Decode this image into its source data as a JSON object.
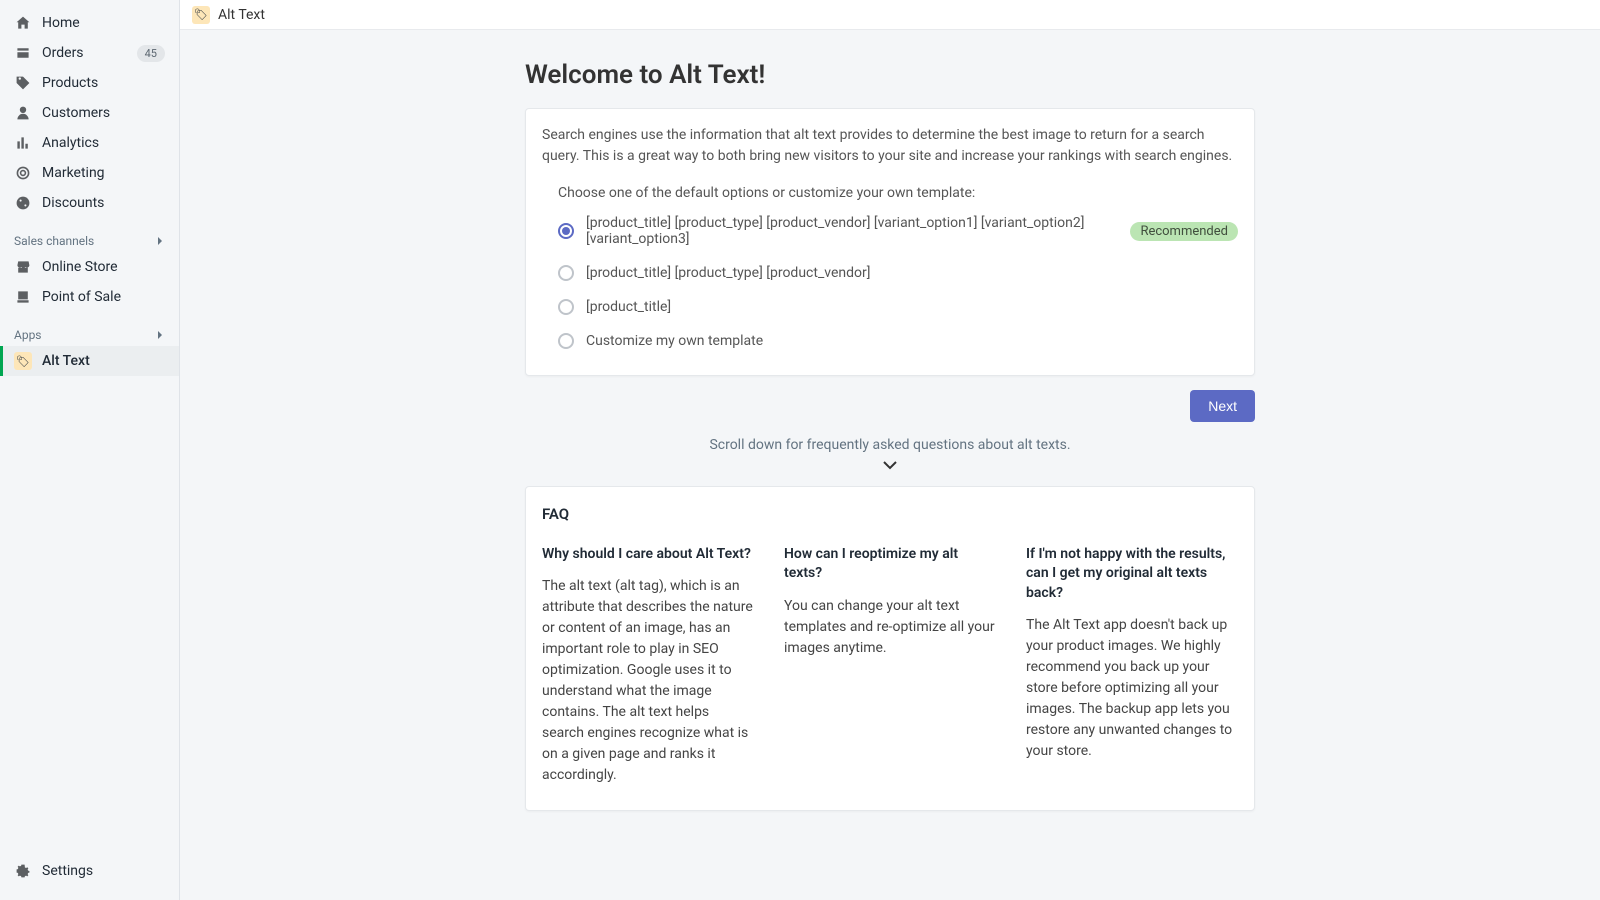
{
  "sidebar": {
    "items": [
      {
        "label": "Home"
      },
      {
        "label": "Orders",
        "badge": "45"
      },
      {
        "label": "Products"
      },
      {
        "label": "Customers"
      },
      {
        "label": "Analytics"
      },
      {
        "label": "Marketing"
      },
      {
        "label": "Discounts"
      }
    ],
    "sales_channels_header": "Sales channels",
    "channels": [
      {
        "label": "Online Store"
      },
      {
        "label": "Point of Sale"
      }
    ],
    "apps_header": "Apps",
    "apps": [
      {
        "label": "Alt Text"
      }
    ],
    "settings_label": "Settings"
  },
  "topbar": {
    "title": "Alt Text"
  },
  "page": {
    "title": "Welcome to Alt Text!",
    "intro": "Search engines use the information that alt text provides to determine the best image to return for a search query. This is a great way to both bring new visitors to your site and increase your rankings with search engines.",
    "choose_label": "Choose one of the default options or customize your own template:",
    "options": [
      {
        "label": "[product_title] [product_type] [product_vendor] [variant_option1] [variant_option2] [variant_option3]",
        "recommended": true,
        "selected": true
      },
      {
        "label": "[product_title] [product_type] [product_vendor]"
      },
      {
        "label": "[product_title]"
      },
      {
        "label": "Customize my own template"
      }
    ],
    "recommended_label": "Recommended",
    "next_label": "Next",
    "scroll_hint": "Scroll down for frequently asked questions about alt texts."
  },
  "faq": {
    "title": "FAQ",
    "items": [
      {
        "q": "Why should I care about Alt Text?",
        "a": "The alt text (alt tag), which is an attribute that describes the nature or content of an image, has an important role to play in SEO optimization. Google uses it to understand what the image contains. The alt text helps search engines recognize what is on a given page and ranks it accordingly."
      },
      {
        "q": "How can I reoptimize my alt texts?",
        "a": "You can change your alt text templates and re-optimize all your images anytime."
      },
      {
        "q": "If I'm not happy with the results, can I get my original alt texts back?",
        "a": "The Alt Text app doesn't back up your product images. We highly recommend you back up your store before optimizing all your images. The backup app lets you restore any unwanted changes to your store."
      }
    ]
  }
}
